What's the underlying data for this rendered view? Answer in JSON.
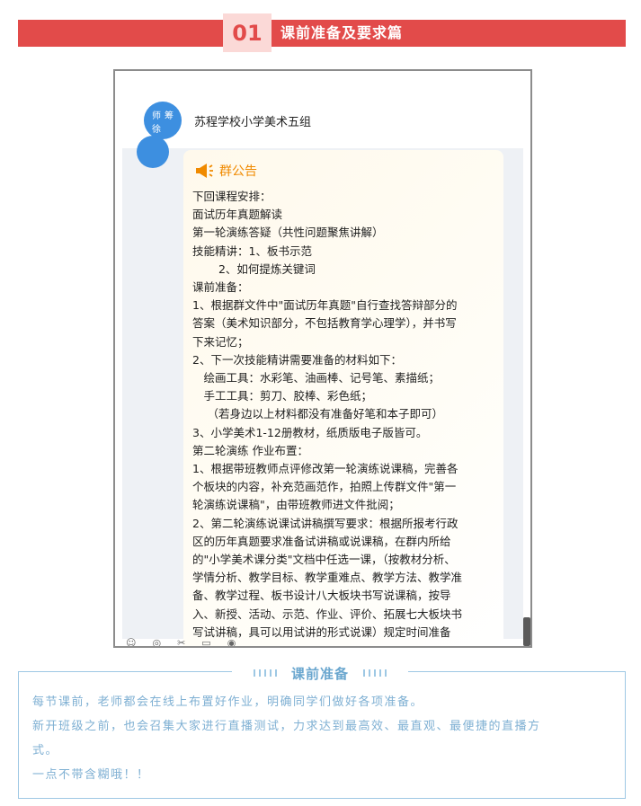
{
  "header": {
    "number": "01",
    "title": "课前准备及要求篇",
    "colors": {
      "banner": "#e24b4a",
      "badge_bg": "#fbd9d7"
    }
  },
  "chat": {
    "group_name": "苏程学校小学美术五组",
    "avatar_chars": [
      "师",
      "筹",
      "徐"
    ],
    "notice": {
      "title": "群公告",
      "icon": "megaphone-icon",
      "lines": [
        "下回课程安排：",
        "面试历年真题解读",
        "第一轮演练答疑（共性问题聚焦讲解）",
        "技能精讲：1、板书示范",
        "　　 2、如何提炼关键词",
        "课前准备：",
        "1、根据群文件中\"面试历年真题\"自行查找答辩部分的",
        "答案（美术知识部分，不包括教育学心理学），并书写",
        "下来记忆；",
        "2、下一次技能精讲需要准备的材料如下：",
        "　绘画工具：水彩笔、油画棒、记号笔、素描纸；",
        "　手工工具：剪刀、胶棒、彩色纸；",
        "　 （若身边以上材料都没有准备好笔和本子即可）",
        "3、小学美术1-12册教材，纸质版电子版皆可。",
        "第二轮演练 作业布置：",
        "1、根据带班教师点评修改第一轮演练说课稿，完善各",
        "个板块的内容，补充范画范作，拍照上传群文件\"第一",
        "轮演练说课稿\"，由带班教师进文件批阅；",
        "2、第二轮演练说课试讲稿撰写要求：根据所报考行政",
        "区的历年真题要求准备试讲稿或说课稿，在群内所给",
        "的\"小学美术课分类\"文档中任选一课，（按教材分析、",
        "学情分析、教学目标、教学重难点、教学方法、教学准",
        "备、教学过程、板书设计八大板块书写说课稿，按导",
        "入、新授、活动、示范、作业、评价、拓展七大板块书",
        "写试讲稿，具可以用试讲的形式说课）规定时间准备"
      ]
    },
    "colors": {
      "notice_title": "#f08a00",
      "avatar": "#3d8fe0"
    }
  },
  "info": {
    "title": "课前准备",
    "paragraphs": [
      "每节课前，老师都会在线上布置好作业，明确同学们做好各项准备。",
      "新开班级之前，也会召集大家进行直播测试，力求达到最高效、最直观、最便捷的直播方",
      "式。",
      "一点不带含糊哦！！"
    ],
    "colors": {
      "text": "#7fb0d3",
      "border": "#9ec8e4"
    }
  }
}
